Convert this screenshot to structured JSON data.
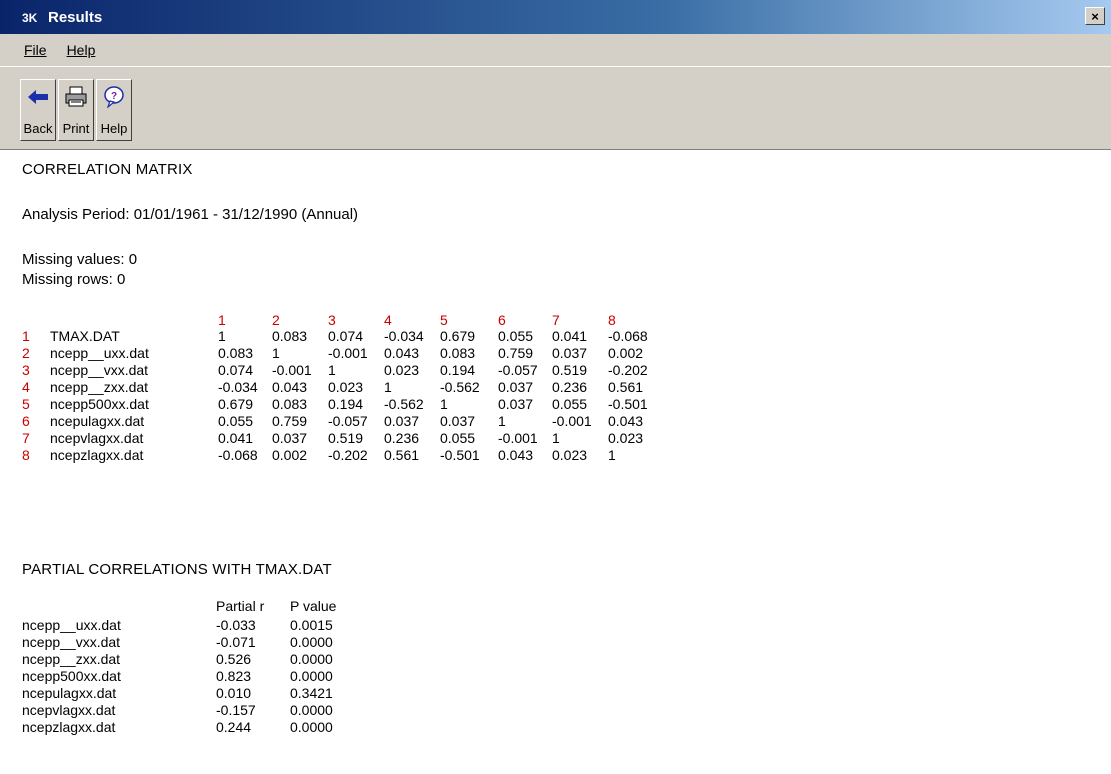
{
  "window": {
    "title": "Results",
    "close_label": "×"
  },
  "menu": {
    "file": "File",
    "help": "Help"
  },
  "toolbar": {
    "back": "Back",
    "print": "Print",
    "help": "Help"
  },
  "content": {
    "heading": "CORRELATION MATRIX",
    "analysis_period": "Analysis Period: 01/01/1961 - 31/12/1990 (Annual)",
    "missing_values": "Missing values:  0",
    "missing_rows": "Missing rows:  0",
    "matrix": {
      "col_headers": [
        "1",
        "2",
        "3",
        "4",
        "5",
        "6",
        "7",
        "8"
      ],
      "rows": [
        {
          "num": "1",
          "name": "TMAX.DAT",
          "values": [
            "1",
            "0.083",
            "0.074",
            "-0.034",
            "0.679",
            "0.055",
            "0.041",
            "-0.068"
          ]
        },
        {
          "num": "2",
          "name": "ncepp__uxx.dat",
          "values": [
            "0.083",
            "1",
            "-0.001",
            "0.043",
            "0.083",
            "0.759",
            "0.037",
            "0.002"
          ]
        },
        {
          "num": "3",
          "name": "ncepp__vxx.dat",
          "values": [
            "0.074",
            "-0.001",
            "1",
            "0.023",
            "0.194",
            "-0.057",
            "0.519",
            "-0.202"
          ]
        },
        {
          "num": "4",
          "name": "ncepp__zxx.dat",
          "values": [
            "-0.034",
            "0.043",
            "0.023",
            "1",
            "-0.562",
            "0.037",
            "0.236",
            "0.561"
          ]
        },
        {
          "num": "5",
          "name": "ncepp500xx.dat",
          "values": [
            "0.679",
            "0.083",
            "0.194",
            "-0.562",
            "1",
            "0.037",
            "0.055",
            "-0.501"
          ]
        },
        {
          "num": "6",
          "name": "ncepulagxx.dat",
          "values": [
            "0.055",
            "0.759",
            "-0.057",
            "0.037",
            "0.037",
            "1",
            "-0.001",
            "0.043"
          ]
        },
        {
          "num": "7",
          "name": "ncepvlagxx.dat",
          "values": [
            "0.041",
            "0.037",
            "0.519",
            "0.236",
            "0.055",
            "-0.001",
            "1",
            "0.023"
          ]
        },
        {
          "num": "8",
          "name": "ncepzlagxx.dat",
          "values": [
            "-0.068",
            "0.002",
            "-0.202",
            "0.561",
            "-0.501",
            "0.043",
            "0.023",
            "1"
          ]
        }
      ]
    },
    "partial_heading": "PARTIAL CORRELATIONS WITH TMAX.DAT",
    "partial": {
      "col_partial": "Partial r",
      "col_pvalue": "P value",
      "rows": [
        {
          "name": "ncepp__uxx.dat",
          "r": "-0.033",
          "p": "0.0015"
        },
        {
          "name": "ncepp__vxx.dat",
          "r": "-0.071",
          "p": "0.0000"
        },
        {
          "name": "ncepp__zxx.dat",
          "r": "0.526",
          "p": "0.0000"
        },
        {
          "name": "ncepp500xx.dat",
          "r": "0.823",
          "p": "0.0000"
        },
        {
          "name": "ncepulagxx.dat",
          "r": "0.010",
          "p": "0.3421"
        },
        {
          "name": "ncepvlagxx.dat",
          "r": "-0.157",
          "p": "0.0000"
        },
        {
          "name": "ncepzlagxx.dat",
          "r": "0.244",
          "p": "0.0000"
        }
      ]
    }
  },
  "colors": {
    "title_bar": "#0a246a",
    "row_number": "#c80000",
    "chrome": "#d4d0c8"
  }
}
